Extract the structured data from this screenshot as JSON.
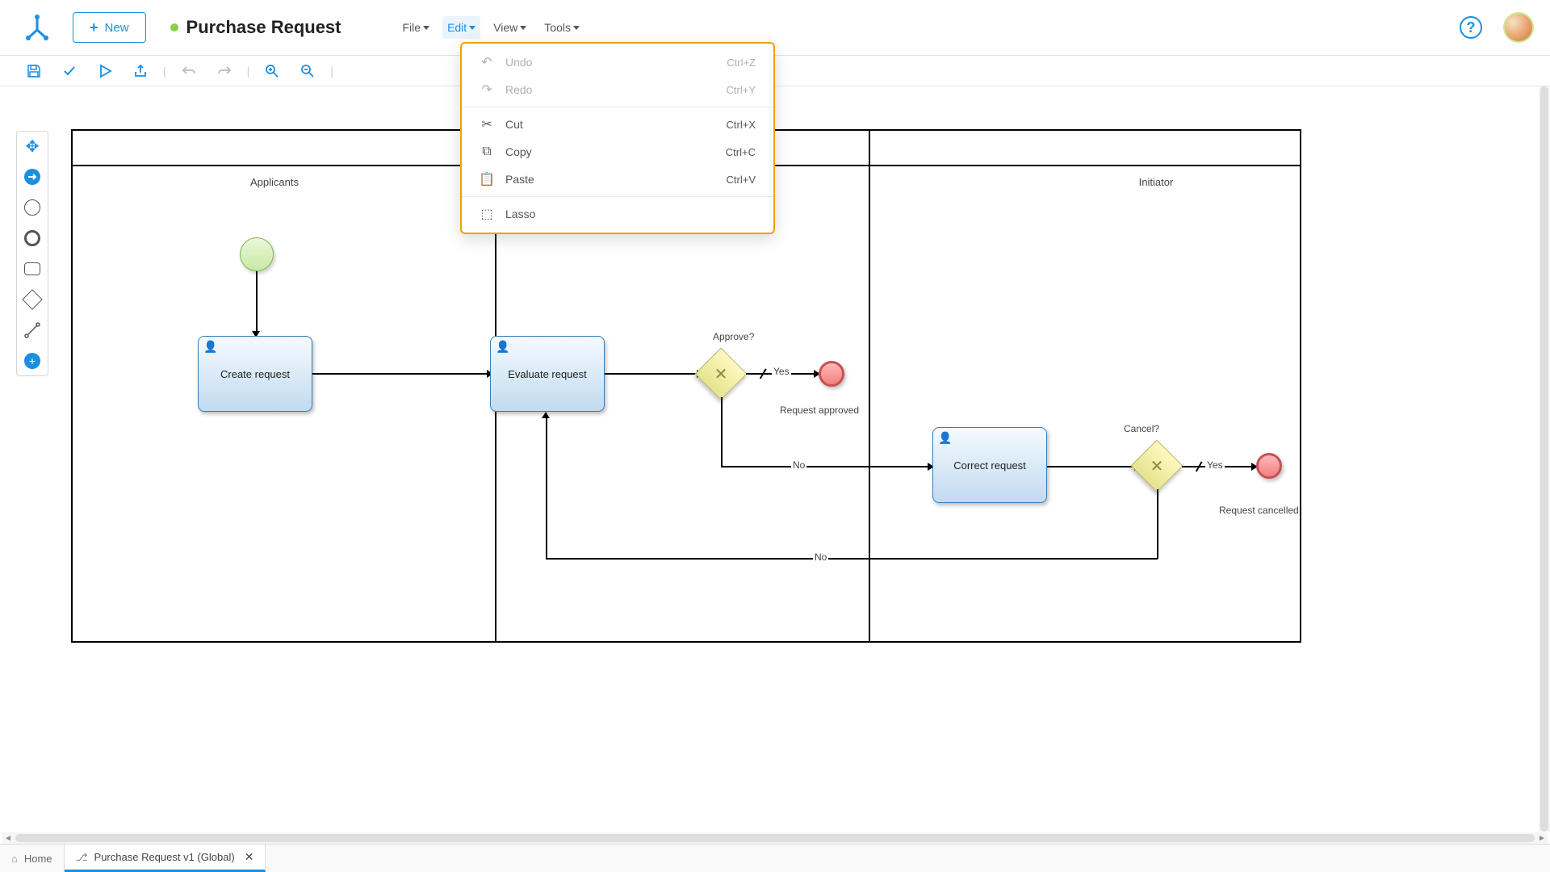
{
  "header": {
    "new_label": "New",
    "title": "Purchase Request",
    "menus": {
      "file": "File",
      "edit": "Edit",
      "view": "View",
      "tools": "Tools"
    }
  },
  "edit_menu": {
    "undo": {
      "label": "Undo",
      "shortcut": "Ctrl+Z"
    },
    "redo": {
      "label": "Redo",
      "shortcut": "Ctrl+Y"
    },
    "cut": {
      "label": "Cut",
      "shortcut": "Ctrl+X"
    },
    "copy": {
      "label": "Copy",
      "shortcut": "Ctrl+C"
    },
    "paste": {
      "label": "Paste",
      "shortcut": "Ctrl+V"
    },
    "lasso": {
      "label": "Lasso"
    }
  },
  "lanes": {
    "applicants": "Applicants",
    "initiator": "Initiator"
  },
  "tasks": {
    "create": "Create request",
    "evaluate": "Evaluate request",
    "correct": "Correct request"
  },
  "gateways": {
    "approve": "Approve?",
    "cancel": "Cancel?"
  },
  "flows": {
    "yes": "Yes",
    "no": "No"
  },
  "events": {
    "approved": "Request approved",
    "cancelled": "Request cancelled"
  },
  "tabs": {
    "home": "Home",
    "doc": "Purchase Request v1 (Global)"
  }
}
